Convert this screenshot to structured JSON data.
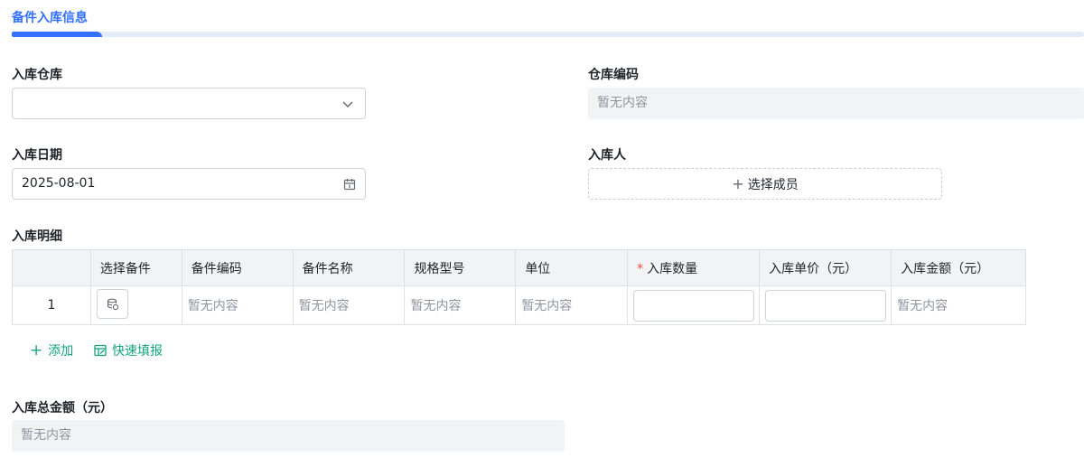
{
  "section": {
    "title": "备件入库信息"
  },
  "fields": {
    "warehouse": {
      "label": "入库仓库",
      "value": ""
    },
    "warehouse_code": {
      "label": "仓库编码",
      "placeholder": "暂无内容"
    },
    "inbound_date": {
      "label": "入库日期",
      "value": "2025-08-01"
    },
    "inbound_person": {
      "label": "入库人",
      "button_label": "选择成员"
    },
    "detail": {
      "label": "入库明细"
    },
    "total_amount": {
      "label": "入库总金额（元）",
      "placeholder": "暂无内容"
    }
  },
  "table": {
    "columns": [
      "",
      "选择备件",
      "备件编码",
      "备件名称",
      "规格型号",
      "单位",
      "入库数量",
      "入库单价（元）",
      "入库金额（元）"
    ],
    "rows": [
      {
        "index": "1",
        "part_code": "暂无内容",
        "part_name": "暂无内容",
        "spec": "暂无内容",
        "unit": "暂无内容",
        "quantity": "",
        "unit_price": "",
        "amount": "暂无内容"
      }
    ]
  },
  "actions": {
    "add": "添加",
    "quick_fill": "快速填报"
  },
  "colors": {
    "accent": "#3370ff",
    "action": "#14a37f",
    "required": "#f54a45"
  },
  "icons": [
    "chevron-down-icon",
    "calendar-icon",
    "plus-icon",
    "parts-picker-icon",
    "quick-fill-icon"
  ]
}
